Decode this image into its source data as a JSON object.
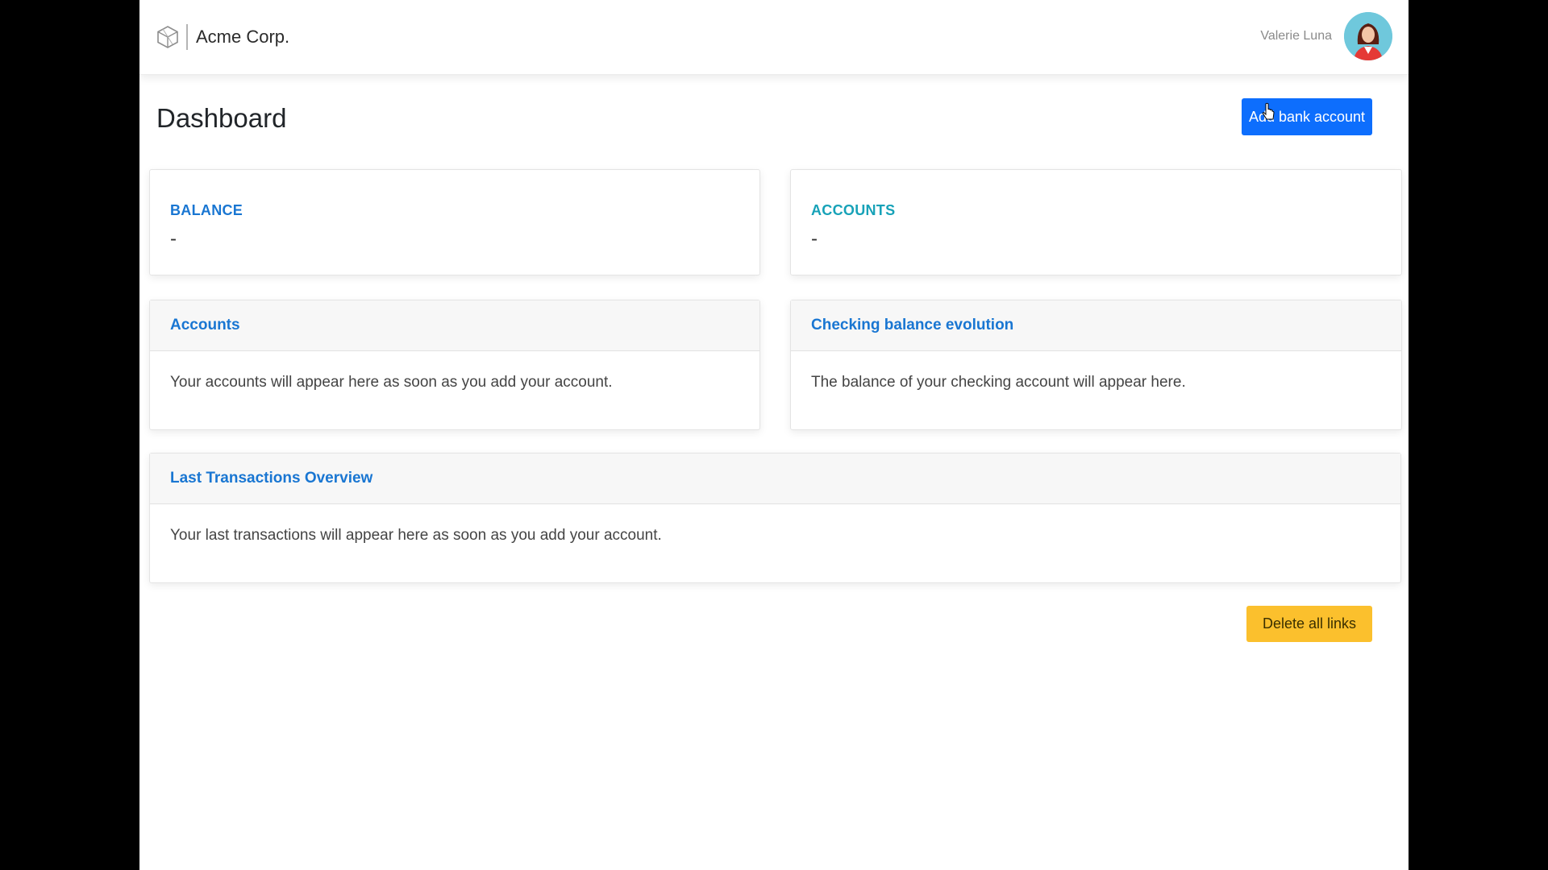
{
  "header": {
    "brand_name": "Acme Corp.",
    "user_name": "Valerie Luna"
  },
  "page": {
    "title": "Dashboard",
    "add_bank_account_label": "Add bank account",
    "delete_all_links_label": "Delete all links"
  },
  "stats": {
    "balance": {
      "label": "BALANCE",
      "value": "-",
      "color": "#1976d2"
    },
    "accounts": {
      "label": "ACCOUNTS",
      "value": "-",
      "color": "#17a2b8"
    }
  },
  "panels": {
    "accounts": {
      "title": "Accounts",
      "body": "Your accounts will appear here as soon as you add your account."
    },
    "checking": {
      "title": "Checking balance evolution",
      "body": "The balance of your checking account will appear here."
    },
    "transactions": {
      "title": "Last Transactions Overview",
      "body": "Your last transactions will appear here as soon as you add your account."
    }
  },
  "colors": {
    "primary": "#0d6efd",
    "warning": "#fbc02d",
    "link": "#1976d2"
  },
  "icons": {
    "brand": "hexagon-logo-icon",
    "avatar": "user-avatar",
    "cursor": "mouse-pointer-icon"
  }
}
